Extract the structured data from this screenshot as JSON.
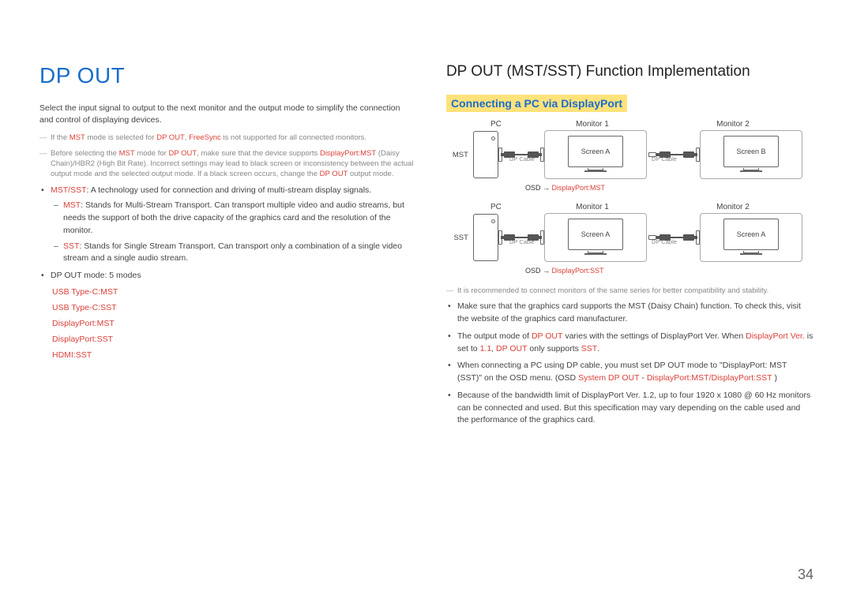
{
  "page_number": "34",
  "left": {
    "title": "DP OUT",
    "intro": "Select the input signal to output to the next monitor and the output mode to simplify the connection and control of displaying devices.",
    "note1_a": "If the ",
    "note1_b": " mode is selected for ",
    "note1_c": ", ",
    "note1_d": " is not supported for all connected monitors.",
    "note2_a": "Before selecting the ",
    "note2_b": " mode for ",
    "note2_c": ", make sure that the device supports ",
    "note2_d": " (Daisy Chain)/HBR2 (High Bit Rate). Incorrect settings may lead to black screen or inconsistency between the actual output mode and the selected output mode. If a black screen occurs, change the ",
    "note2_e": " output mode.",
    "mst_sst_label": "MST/SST",
    "mst_sst_def": ": A technology used for connection and driving of multi-stream display signals.",
    "mst_label": "MST",
    "mst_def": ": Stands for Multi-Stream Transport. Can transport multiple video and audio streams, but needs the support of both the drive capacity of the graphics card and the resolution of the monitor.",
    "sst_label": "SST",
    "sst_def": ": Stands for Single Stream Transport. Can transport only a combination of a single video stream and a single audio stream.",
    "modes_heading": "DP OUT mode: 5 modes",
    "modes": {
      "m1": "USB Type-C:MST",
      "m2": "USB Type-C:SST",
      "m3": "DisplayPort:MST",
      "m4": "DisplayPort:SST",
      "m5": "HDMI:SST"
    },
    "red_mst": "MST",
    "red_dpout": "DP OUT",
    "red_freesync": "FreeSync",
    "red_dp_mst": "DisplayPort:MST"
  },
  "right": {
    "title": "DP OUT (MST/SST) Function Implementation",
    "subtitle": "Connecting a PC via DisplayPort",
    "headers": {
      "pc": "PC",
      "mon1": "Monitor 1",
      "mon2": "Monitor 2"
    },
    "row1": {
      "label": "MST",
      "screen1": "Screen A",
      "screen2": "Screen B",
      "cable": "DP Cable",
      "osd_a": "OSD → ",
      "osd_b": "DisplayPort:MST"
    },
    "row2": {
      "label": "SST",
      "screen1": "Screen A",
      "screen2": "Screen A",
      "cable": "DP Cable",
      "osd_a": "OSD → ",
      "osd_b": "DisplayPort:SST"
    },
    "note3": "It is recommended to connect monitors of the same series for better compatibility and stability.",
    "b1": "Make sure that the graphics card supports the MST (Daisy Chain) function. To check this, visit the website of the graphics card manufacturer.",
    "b2_a": "The output mode of ",
    "b2_b": " varies with the settings of DisplayPort Ver. When ",
    "b2_c": " is set to ",
    "b2_d": ", ",
    "b2_e": " only supports ",
    "b2_f": ".",
    "b3_a": "When connecting a PC using DP cable, you must set DP OUT mode to \"DisplayPort: MST (SST)\" on the OSD menu. (OSD ",
    "b3_b": "  ",
    "b3_c": " - ",
    "b3_d": " )",
    "b4": "Because of the bandwidth limit of DisplayPort Ver. 1.2, up to four 1920 x 1080 @ 60 Hz monitors can be connected and used. But this specification may vary depending on the cable used and the performance of the graphics card.",
    "red_dpout": "DP OUT",
    "red_dpver": "DisplayPort Ver.",
    "red_11": "1.1",
    "red_sst": "SST",
    "red_system": "System",
    "red_dpmstsst": "DisplayPort:MST/DisplayPort:SST"
  }
}
